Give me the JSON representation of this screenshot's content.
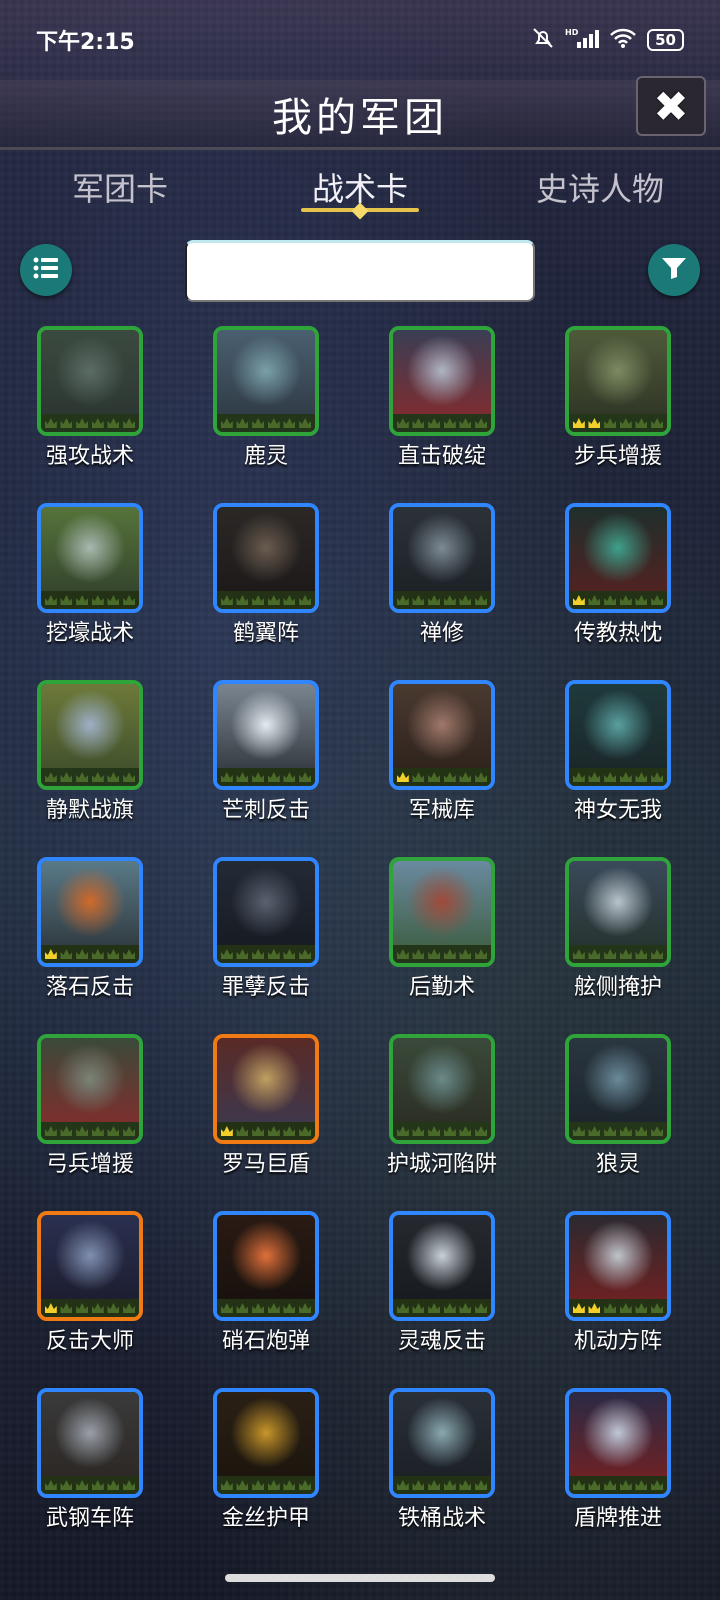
{
  "status_bar": {
    "time": "下午2:15",
    "icons": [
      "bell-muted-icon",
      "hd-signal-icon",
      "wifi-icon"
    ],
    "battery": "50"
  },
  "header": {
    "title": "我的军团",
    "close_icon": "close-icon"
  },
  "tabs": [
    {
      "label": "军团卡",
      "active": false
    },
    {
      "label": "战术卡",
      "active": true
    },
    {
      "label": "史诗人物",
      "active": false
    }
  ],
  "toolbar": {
    "list_icon": "list-icon",
    "filter_icon": "filter-icon",
    "search_value": ""
  },
  "colors": {
    "common_border": "#2ea43a",
    "rare_border": "#2f86ff",
    "epic_border": "#f07a14",
    "accent_teal": "#1b7a78",
    "tab_underline": "#e6c24a"
  },
  "cards": [
    {
      "label": "强攻战术",
      "rarity": "common",
      "crowns": 0,
      "art": [
        "#3b4a3f",
        "#5c6d66",
        "#2a3330"
      ]
    },
    {
      "label": "鹿灵",
      "rarity": "common",
      "crowns": 0,
      "art": [
        "#4a5f70",
        "#7aa0a8",
        "#2c3640"
      ]
    },
    {
      "label": "直击破绽",
      "rarity": "common",
      "crowns": 0,
      "art": [
        "#3a3e55",
        "#b0b5c4",
        "#8a2a2a"
      ]
    },
    {
      "label": "步兵增援",
      "rarity": "common",
      "crowns": 2,
      "art": [
        "#4f5a3a",
        "#7c8a62",
        "#2b3022"
      ]
    },
    {
      "label": "挖壕战术",
      "rarity": "rare",
      "crowns": 0,
      "art": [
        "#56743a",
        "#a8b8b0",
        "#2f3c2a"
      ]
    },
    {
      "label": "鹤翼阵",
      "rarity": "rare",
      "crowns": 0,
      "art": [
        "#2c2826",
        "#6a5c50",
        "#1a1717"
      ]
    },
    {
      "label": "禅修",
      "rarity": "rare",
      "crowns": 0,
      "art": [
        "#2b3238",
        "#7d8a94",
        "#1a1f24"
      ]
    },
    {
      "label": "传教热忱",
      "rarity": "rare",
      "crowns": 1,
      "art": [
        "#1f2f2c",
        "#3fa08a",
        "#5a2020"
      ]
    },
    {
      "label": "静默战旗",
      "rarity": "common",
      "crowns": 0,
      "art": [
        "#6d7a3a",
        "#9fb0c8",
        "#3a4a2a"
      ]
    },
    {
      "label": "芒刺反击",
      "rarity": "rare",
      "crowns": 0,
      "art": [
        "#7a8590",
        "#e4ebf0",
        "#2a2f35"
      ]
    },
    {
      "label": "军械库",
      "rarity": "rare",
      "crowns": 1,
      "art": [
        "#4a3a30",
        "#a0786a",
        "#2a1f1a"
      ]
    },
    {
      "label": "神女无我",
      "rarity": "rare",
      "crowns": 0,
      "art": [
        "#1f3a3c",
        "#5aa0a0",
        "#1a2426"
      ]
    },
    {
      "label": "落石反击",
      "rarity": "rare",
      "crowns": 1,
      "art": [
        "#5a7a88",
        "#d06a2a",
        "#2a3035"
      ]
    },
    {
      "label": "罪孽反击",
      "rarity": "rare",
      "crowns": 0,
      "art": [
        "#232a36",
        "#5a6270",
        "#15191f"
      ]
    },
    {
      "label": "后勤术",
      "rarity": "common",
      "crowns": 0,
      "art": [
        "#6a8aa0",
        "#a04a3a",
        "#3a5a3a"
      ]
    },
    {
      "label": "舷侧掩护",
      "rarity": "common",
      "crowns": 0,
      "art": [
        "#3a4a5a",
        "#b8c4cc",
        "#23302a"
      ]
    },
    {
      "label": "弓兵增援",
      "rarity": "common",
      "crowns": 0,
      "art": [
        "#3a4a3a",
        "#7a8478",
        "#8a2a2a"
      ]
    },
    {
      "label": "罗马巨盾",
      "rarity": "epic",
      "crowns": 1,
      "art": [
        "#5a2a26",
        "#c0a060",
        "#3a3a52"
      ]
    },
    {
      "label": "护城河陷阱",
      "rarity": "common",
      "crowns": 0,
      "art": [
        "#3a4a3a",
        "#6a8a8a",
        "#2a2a20"
      ]
    },
    {
      "label": "狼灵",
      "rarity": "common",
      "crowns": 0,
      "art": [
        "#2a3640",
        "#6a8a9a",
        "#1a2228"
      ]
    },
    {
      "label": "反击大师",
      "rarity": "epic",
      "crowns": 1,
      "art": [
        "#2a3050",
        "#8090b0",
        "#1a1a2a"
      ]
    },
    {
      "label": "硝石炮弹",
      "rarity": "rare",
      "crowns": 0,
      "art": [
        "#2a1a14",
        "#e0703a",
        "#15100c"
      ]
    },
    {
      "label": "灵魂反击",
      "rarity": "rare",
      "crowns": 0,
      "art": [
        "#262a30",
        "#c8d0d8",
        "#15181c"
      ]
    },
    {
      "label": "机动方阵",
      "rarity": "rare",
      "crowns": 2,
      "art": [
        "#2a2a30",
        "#c0c4cc",
        "#7a2020"
      ]
    },
    {
      "label": "武钢车阵",
      "rarity": "rare",
      "crowns": 0,
      "art": [
        "#3a3a3a",
        "#9aa0a8",
        "#2a2522"
      ]
    },
    {
      "label": "金丝护甲",
      "rarity": "rare",
      "crowns": 0,
      "art": [
        "#2a2015",
        "#c8962a",
        "#1a140c"
      ]
    },
    {
      "label": "铁桶战术",
      "rarity": "rare",
      "crowns": 0,
      "art": [
        "#2a3038",
        "#8aa8b0",
        "#1a1e24"
      ]
    },
    {
      "label": "盾牌推进",
      "rarity": "rare",
      "crowns": 0,
      "art": [
        "#2a2a44",
        "#c0c8d8",
        "#7a2020"
      ]
    }
  ]
}
